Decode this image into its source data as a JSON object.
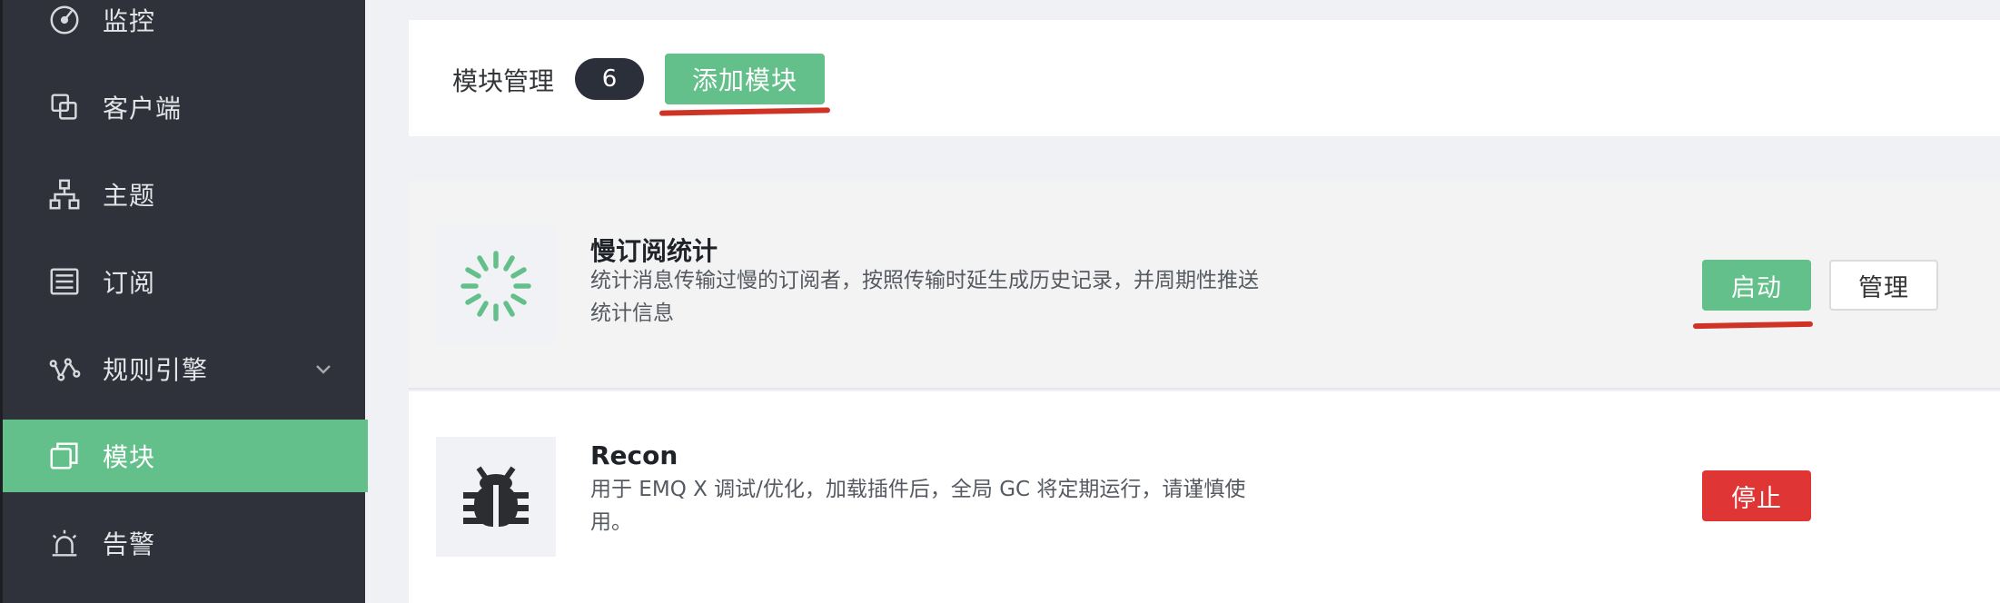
{
  "sidebar": {
    "items": [
      {
        "label": "监控",
        "icon": "dashboard-icon"
      },
      {
        "label": "客户端",
        "icon": "clients-icon"
      },
      {
        "label": "主题",
        "icon": "topics-icon"
      },
      {
        "label": "订阅",
        "icon": "subscriptions-icon"
      },
      {
        "label": "规则引擎",
        "icon": "rule-engine-icon",
        "expandable": true
      },
      {
        "label": "模块",
        "icon": "modules-icon",
        "active": true
      },
      {
        "label": "告警",
        "icon": "alarm-icon"
      }
    ]
  },
  "header": {
    "title": "模块管理",
    "count": "6",
    "add_label": "添加模块"
  },
  "modules": [
    {
      "title": "慢订阅统计",
      "description": "统计消息传输过慢的订阅者，按照传输时延生成历史记录，并周期性推送统计信息",
      "icon": "loading-spinner-icon",
      "start_label": "启动",
      "manage_label": "管理"
    },
    {
      "title": "Recon",
      "description": "用于 EMQ X 调试/优化，加载插件后，全局 GC 将定期运行，请谨慎使用。",
      "icon": "bug-icon",
      "stop_label": "停止"
    }
  ],
  "colors": {
    "sidebar_bg": "#2f323a",
    "accent_green": "#63c08a",
    "danger_red": "#e03535",
    "annotation_red": "#cf3325"
  }
}
